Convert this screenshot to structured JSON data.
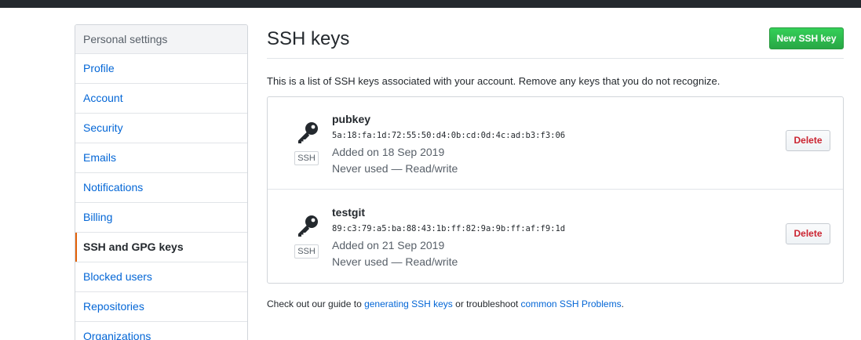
{
  "sidebar": {
    "header": "Personal settings",
    "items": [
      {
        "label": "Profile"
      },
      {
        "label": "Account"
      },
      {
        "label": "Security"
      },
      {
        "label": "Emails"
      },
      {
        "label": "Notifications"
      },
      {
        "label": "Billing"
      },
      {
        "label": "SSH and GPG keys",
        "selected": true
      },
      {
        "label": "Blocked users"
      },
      {
        "label": "Repositories"
      },
      {
        "label": "Organizations"
      }
    ]
  },
  "main": {
    "title": "SSH keys",
    "new_key_label": "New SSH key",
    "intro": "This is a list of SSH keys associated with your account. Remove any keys that you do not recognize.",
    "keys": [
      {
        "title": "pubkey",
        "fingerprint": "5a:18:fa:1d:72:55:50:d4:0b:cd:0d:4c:ad:b3:f3:06",
        "added": "Added on 18 Sep 2019",
        "usage": "Never used — Read/write",
        "badge": "SSH",
        "delete_label": "Delete",
        "icon": "key-icon"
      },
      {
        "title": "testgit",
        "fingerprint": "89:c3:79:a5:ba:88:43:1b:ff:82:9a:9b:ff:af:f9:1d",
        "added": "Added on 21 Sep 2019",
        "usage": "Never used — Read/write",
        "badge": "SSH",
        "delete_label": "Delete",
        "icon": "key-icon"
      }
    ],
    "footer": {
      "prefix": "Check out our guide to ",
      "link1": "generating SSH keys",
      "middle": " or troubleshoot ",
      "link2": "common SSH Problems",
      "suffix": "."
    }
  },
  "colors": {
    "topbar": "#24292e",
    "link": "#0366d6",
    "selected_accent": "#e36209",
    "primary_button": "#28a745",
    "danger_text": "#cb2431"
  }
}
